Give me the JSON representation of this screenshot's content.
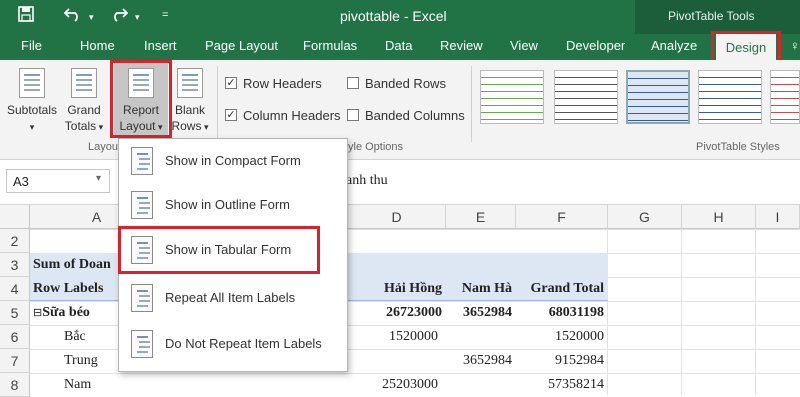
{
  "app": {
    "title": "pivottable - Excel",
    "contextual_group": "PivotTable Tools"
  },
  "tabs": [
    "File",
    "Home",
    "Insert",
    "Page Layout",
    "Formulas",
    "Data",
    "Review",
    "View",
    "Developer",
    "Analyze",
    "Design"
  ],
  "ribbon": {
    "subtotals_label": "Subtotals",
    "grand_totals_label": [
      "Grand",
      "Totals"
    ],
    "report_layout_label": [
      "Report",
      "Layout"
    ],
    "blank_rows_label": [
      "Blank",
      "Rows"
    ],
    "layout_group_label": "Layou",
    "row_headers": {
      "label": "Row Headers",
      "checked": true
    },
    "column_headers": {
      "label": "Column Headers",
      "checked": true
    },
    "banded_rows": {
      "label": "Banded Rows",
      "checked": false
    },
    "banded_columns": {
      "label": "Banded Columns",
      "checked": false
    },
    "style_options_group_label": "yle Options",
    "styles_group_label": "PivotTable Styles"
  },
  "formula_bar": {
    "name_box": "A3",
    "content": "anh thu"
  },
  "grid": {
    "columns": [
      "A",
      "D",
      "E",
      "F",
      "G",
      "H",
      "I"
    ],
    "rows": [
      "2",
      "3",
      "4",
      "5",
      "6",
      "7",
      "8"
    ],
    "a3": "Sum of Doan",
    "a4": "Row Labels",
    "a5": "Sữa béo",
    "a6": "Bắc",
    "a7": "Trung",
    "a8": "Nam",
    "d4": "Hải Hồng",
    "e4": "Nam Hà",
    "f4": "Grand Total",
    "d5": "26723000",
    "e5": "3652984",
    "f5": "68031198",
    "d6": "1520000",
    "f6": "1520000",
    "e7": "3652984",
    "f7": "9152984",
    "d8": "25203000",
    "f8": "57358214"
  },
  "report_layout_menu": [
    "Show in Compact Form",
    "Show in Outline Form",
    "Show in Tabular Form",
    "Repeat All Item Labels",
    "Do Not Repeat Item Labels"
  ],
  "colors": {
    "excel_green": "#217346",
    "highlight_red": "#d6242c",
    "pivot_header_fill": "#dde7f3"
  }
}
